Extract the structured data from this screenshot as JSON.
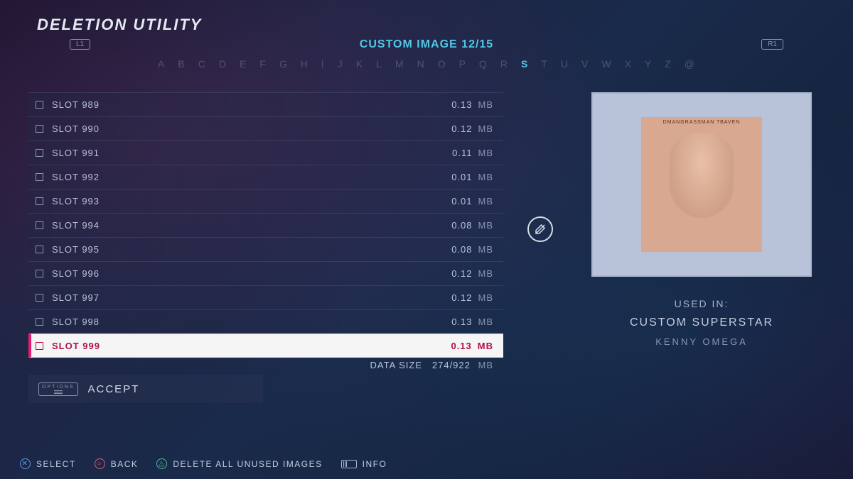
{
  "header": {
    "title": "DELETION UTILITY",
    "shoulder_left": "L1",
    "shoulder_right": "R1",
    "tab_label": "CUSTOM IMAGE 12/15",
    "alphabet": [
      "A",
      "B",
      "C",
      "D",
      "E",
      "F",
      "G",
      "H",
      "I",
      "J",
      "K",
      "L",
      "M",
      "N",
      "O",
      "P",
      "Q",
      "R",
      "S",
      "T",
      "U",
      "V",
      "W",
      "X",
      "Y",
      "Z",
      "@"
    ],
    "alphabet_active": "S"
  },
  "slots": [
    {
      "name": "SLOT 989",
      "size": "0.13",
      "unit": "MB",
      "selected": false
    },
    {
      "name": "SLOT 990",
      "size": "0.12",
      "unit": "MB",
      "selected": false
    },
    {
      "name": "SLOT 991",
      "size": "0.11",
      "unit": "MB",
      "selected": false
    },
    {
      "name": "SLOT 992",
      "size": "0.01",
      "unit": "MB",
      "selected": false
    },
    {
      "name": "SLOT 993",
      "size": "0.01",
      "unit": "MB",
      "selected": false
    },
    {
      "name": "SLOT 994",
      "size": "0.08",
      "unit": "MB",
      "selected": false
    },
    {
      "name": "SLOT 995",
      "size": "0.08",
      "unit": "MB",
      "selected": false
    },
    {
      "name": "SLOT 996",
      "size": "0.12",
      "unit": "MB",
      "selected": false
    },
    {
      "name": "SLOT 997",
      "size": "0.12",
      "unit": "MB",
      "selected": false
    },
    {
      "name": "SLOT 998",
      "size": "0.13",
      "unit": "MB",
      "selected": false
    },
    {
      "name": "SLOT 999",
      "size": "0.13",
      "unit": "MB",
      "selected": true
    }
  ],
  "datasize": {
    "label": "DATA SIZE",
    "value": "274/922",
    "unit": "MB"
  },
  "accept": {
    "button_hint": "OPTIONS",
    "label": "ACCEPT"
  },
  "preview": {
    "thumb_caption": "DMANGRASSMAN ?BAVEN",
    "used_in_label": "USED IN:",
    "category": "CUSTOM SUPERSTAR",
    "name": "KENNY OMEGA"
  },
  "footer": {
    "select": "SELECT",
    "back": "BACK",
    "delete_all": "DELETE ALL UNUSED IMAGES",
    "info": "INFO"
  }
}
